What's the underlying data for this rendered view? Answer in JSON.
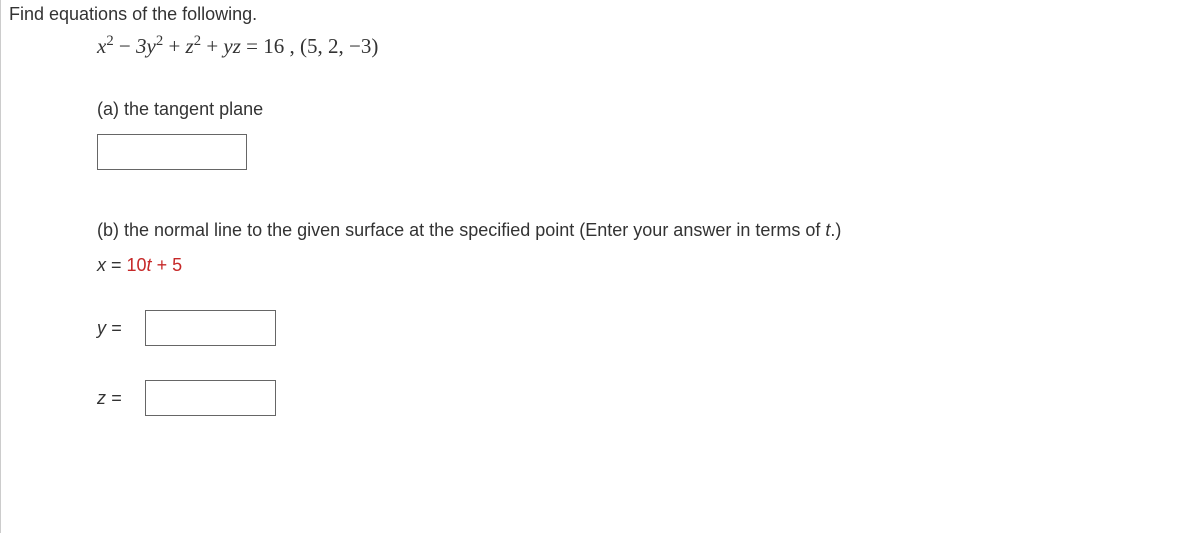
{
  "header": {
    "instruction": "Find equations of the following."
  },
  "equation": {
    "text": "x² − 3y² + z² + yz = 16 , (5, 2, −3)"
  },
  "partA": {
    "label": "(a) the tangent plane"
  },
  "partB": {
    "label_prefix": "(b) the normal line to the given surface at the specified point (Enter your answer in terms of ",
    "label_var": "t",
    "label_suffix": ".)",
    "x": {
      "var": "x",
      "eq": " = ",
      "answer": "10t + 5"
    },
    "y": {
      "label": "y ="
    },
    "z": {
      "label": "z ="
    }
  }
}
